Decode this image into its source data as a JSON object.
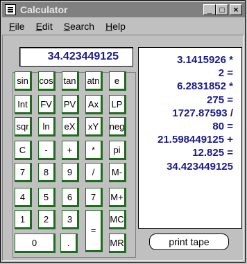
{
  "app": {
    "title": "Calculator"
  },
  "window_buttons": {
    "minimize": "_",
    "maximize": "□",
    "close": "×"
  },
  "menu": [
    "File",
    "Edit",
    "Search",
    "Help"
  ],
  "display": {
    "value": "34.423449125"
  },
  "keys": [
    [
      "sin",
      "cos",
      "tan",
      "atn",
      "e"
    ],
    [
      "Int",
      "FV",
      "PV",
      "Ax",
      "LP"
    ],
    [
      "sqr",
      "ln",
      "eX",
      "xY",
      "neg"
    ],
    [
      "C",
      "-",
      "+",
      "*",
      "pi"
    ],
    [
      "7",
      "8",
      "9",
      "/",
      "M-"
    ],
    [
      "4",
      "5",
      "6",
      "7",
      "M+"
    ],
    [
      "1",
      "2",
      "3",
      "=",
      "MC"
    ],
    [
      "0",
      ".",
      "MR"
    ]
  ],
  "tape": [
    "3.1415926  *",
    "2 =",
    "6.2831852 *",
    "275 =",
    "1727.87593 /",
    "80 =",
    "21.598449125 +",
    "12.825 =",
    "34.423449125"
  ],
  "print_button": {
    "label": "print tape"
  }
}
